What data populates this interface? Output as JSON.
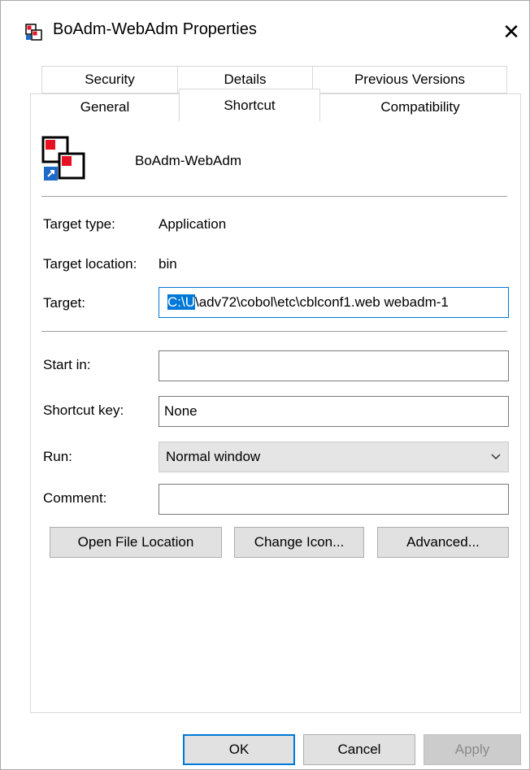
{
  "window": {
    "title": "BoAdm-WebAdm Properties",
    "close_glyph": "✕"
  },
  "tabs": {
    "row1": [
      "Security",
      "Details",
      "Previous Versions"
    ],
    "row2": [
      "General",
      "Shortcut",
      "Compatibility"
    ],
    "active": "Shortcut"
  },
  "shortcut": {
    "name": "BoAdm-WebAdm",
    "target_type_label": "Target type:",
    "target_type_value": "Application",
    "target_location_label": "Target location:",
    "target_location_value": "bin",
    "target_label": "Target:",
    "target_value_selected": "C:\\U",
    "target_value_rest": "\\adv72\\cobol\\etc\\cblconf1.web webadm-1",
    "start_in_label": "Start in:",
    "start_in_value": "",
    "shortcut_key_label": "Shortcut key:",
    "shortcut_key_value": "None",
    "run_label": "Run:",
    "run_value": "Normal window",
    "comment_label": "Comment:",
    "comment_value": ""
  },
  "buttons": {
    "open_file_location": "Open File Location",
    "change_icon": "Change Icon...",
    "advanced": "Advanced...",
    "ok": "OK",
    "cancel": "Cancel",
    "apply": "Apply"
  },
  "icons": {
    "title_icon": "shortcut-app-icon",
    "app_icon": "shortcut-app-icon",
    "close": "close-icon",
    "dropdown": "chevron-down-icon"
  },
  "colors": {
    "accent": "#0078d7",
    "selection": "#0078d7",
    "button_bg": "#e1e1e1",
    "disabled_text": "#8a8a8a"
  }
}
